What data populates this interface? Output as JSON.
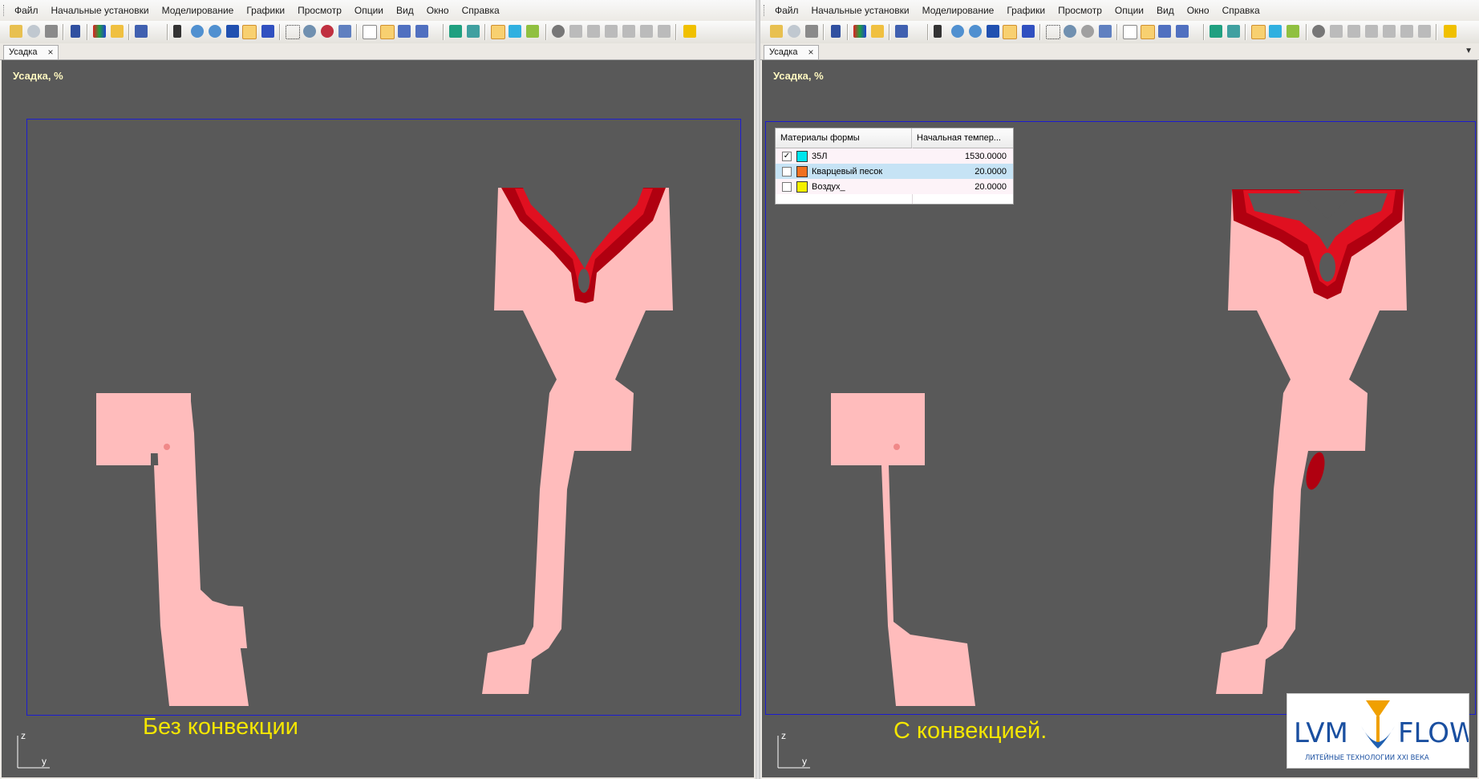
{
  "menu": [
    "Файл",
    "Начальные установки",
    "Моделирование",
    "Графики",
    "Просмотр",
    "Опции",
    "Вид",
    "Окно",
    "Справка"
  ],
  "tab_label": "Усадка",
  "tab_close": "×",
  "viewport_title": "Усадка, %",
  "axis_labels": {
    "z": "z",
    "y": "y"
  },
  "left_caption": "Без конвекции",
  "right_caption": "С конвекцией.",
  "legend": {
    "headers": [
      "Материалы формы",
      "Начальная темпер..."
    ],
    "rows": [
      {
        "checked": true,
        "checkmark": "✓",
        "color": "#00e5ee",
        "name": "35Л",
        "value": "1530.0000"
      },
      {
        "checked": false,
        "checkmark": "",
        "color": "#f07020",
        "name": "Кварцевый песок",
        "value": "20.0000"
      },
      {
        "checked": false,
        "checkmark": "",
        "color": "#f4f000",
        "name": "Воздух_",
        "value": "20.0000"
      }
    ]
  },
  "logo": {
    "left": "LVM",
    "right": "FLOW",
    "tagline": "ЛИТЕЙНЫЕ ТЕХНОЛОГИИ XXI ВЕКА"
  },
  "colors": {
    "viewport_bg": "#595959",
    "casting": "#ffbcbc",
    "shrinkage_dark": "#b00010",
    "shrinkage_mid": "#e01020",
    "frame": "#1c1cd0",
    "caption": "#f4e600"
  }
}
